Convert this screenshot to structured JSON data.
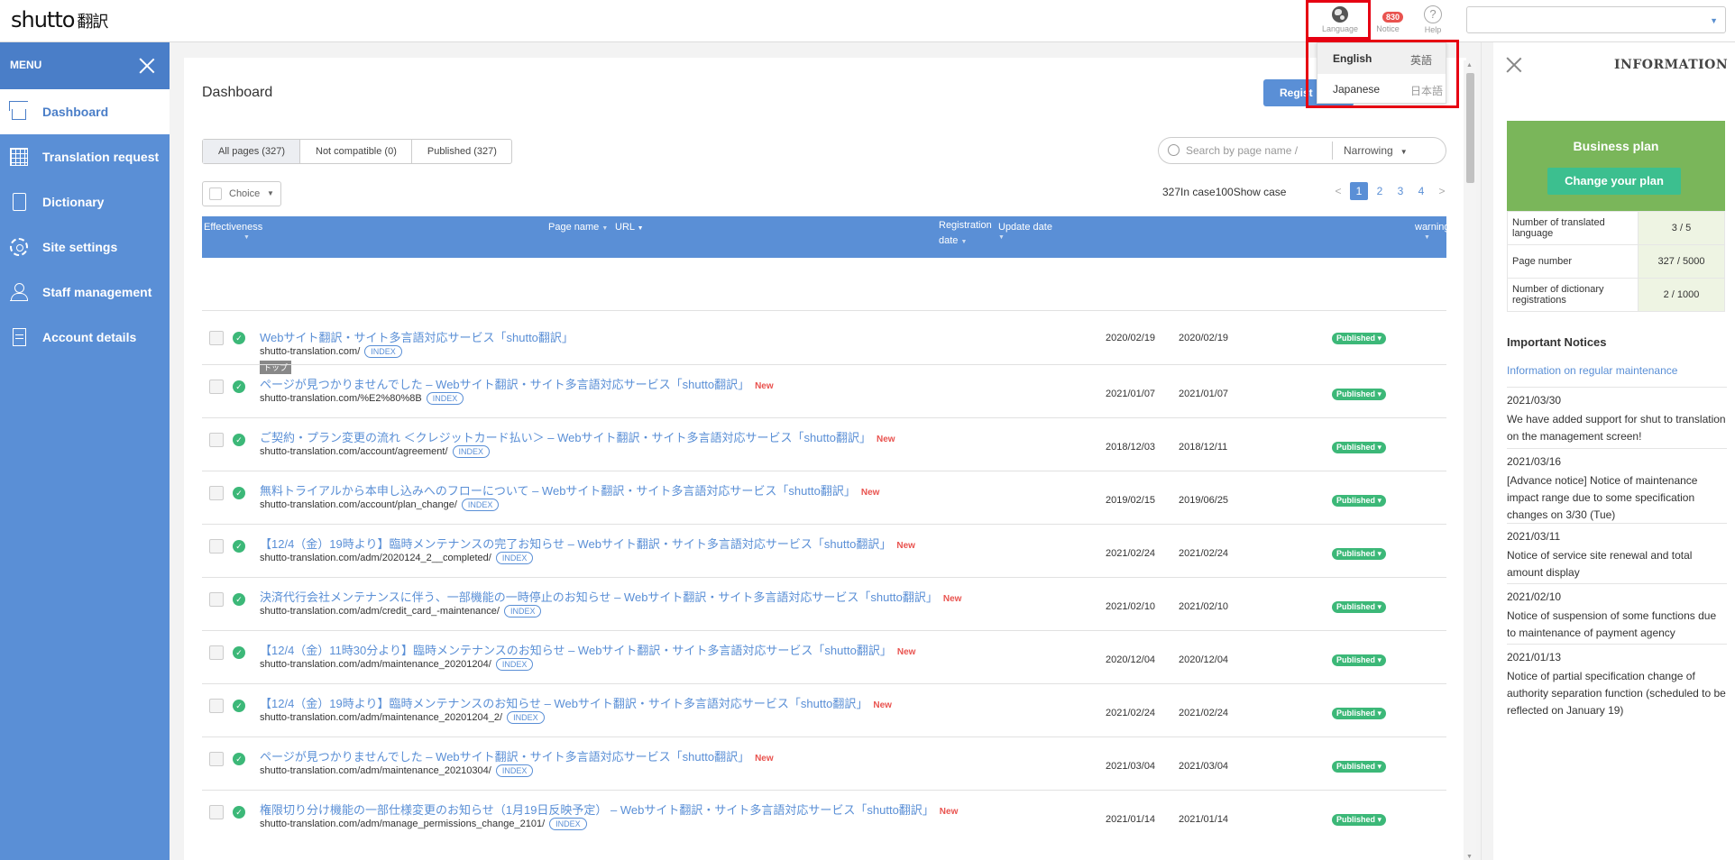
{
  "header": {
    "logo_en": "shutto",
    "logo_jp": "翻訳",
    "language_label": "Language",
    "notice_label": "Notice",
    "notice_count": "830",
    "help_label": "Help",
    "help_glyph": "?",
    "select_value": ""
  },
  "language_menu": {
    "options": [
      {
        "name": "English",
        "native": "英語",
        "selected": true
      },
      {
        "name": "Japanese",
        "native": "日本語",
        "selected": false
      }
    ],
    "highlight_color": "#e60012"
  },
  "sidebar": {
    "title": "MENU",
    "items": [
      {
        "label": "Dashboard",
        "icon": "home-icon",
        "active": true
      },
      {
        "label": "Translation request",
        "icon": "grid-icon"
      },
      {
        "label": "Dictionary",
        "icon": "book-icon"
      },
      {
        "label": "Site settings",
        "icon": "gear-icon"
      },
      {
        "label": "Staff management",
        "icon": "staff-icon"
      },
      {
        "label": "Account details",
        "icon": "document-icon"
      }
    ]
  },
  "main": {
    "title": "Dashboard",
    "register_button": "Regist",
    "tabs": [
      "All pages (327)",
      "Not compatible (0)",
      "Published (327)"
    ],
    "search_placeholder": "Search by page name / ",
    "narrowing": "Narrowing",
    "choice": "Choice",
    "count_text": "327In case100Show case",
    "pages": [
      "<",
      "1",
      "2",
      "3",
      "4",
      ">"
    ],
    "columns": {
      "effectiveness": "Effectiveness",
      "page_name": "Page name",
      "url": "URL",
      "registration_date_1": "Registration",
      "registration_date_2": "date",
      "update_date": "Update date",
      "warning": "warning"
    },
    "status_label": "Published",
    "index_label": "INDEX",
    "new_label": "New",
    "rows": [
      {
        "title": "Webサイト翻訳・サイト多言語対応サービス「shutto翻訳」",
        "url": "shutto-translation.com/",
        "reg": "2020/02/19",
        "upd": "2020/02/19",
        "new": false,
        "tag": "トップ"
      },
      {
        "title": "ページが見つかりませんでした – Webサイト翻訳・サイト多言語対応サービス「shutto翻訳」",
        "url": "shutto-translation.com/%E2%80%8B",
        "reg": "2021/01/07",
        "upd": "2021/01/07",
        "new": true
      },
      {
        "title": "ご契約・プラン変更の流れ ＜クレジットカード払い＞ – Webサイト翻訳・サイト多言語対応サービス「shutto翻訳」",
        "url": "shutto-translation.com/account/agreement/",
        "reg": "2018/12/03",
        "upd": "2018/12/11",
        "new": true
      },
      {
        "title": "無料トライアルから本申し込みへのフローについて – Webサイト翻訳・サイト多言語対応サービス「shutto翻訳」",
        "url": "shutto-translation.com/account/plan_change/",
        "reg": "2019/02/15",
        "upd": "2019/06/25",
        "new": true
      },
      {
        "title": "【12/4（金）19時より】臨時メンテナンスの完了お知らせ – Webサイト翻訳・サイト多言語対応サービス「shutto翻訳」",
        "url": "shutto-translation.com/adm/2020124_2__completed/",
        "reg": "2021/02/24",
        "upd": "2021/02/24",
        "new": true
      },
      {
        "title": "決済代行会社メンテナンスに伴う、一部機能の一時停止のお知らせ – Webサイト翻訳・サイト多言語対応サービス「shutto翻訳」",
        "url": "shutto-translation.com/adm/credit_card_-maintenance/",
        "reg": "2021/02/10",
        "upd": "2021/02/10",
        "new": true
      },
      {
        "title": "【12/4（金）11時30分より】臨時メンテナンスのお知らせ – Webサイト翻訳・サイト多言語対応サービス「shutto翻訳」",
        "url": "shutto-translation.com/adm/maintenance_20201204/",
        "reg": "2020/12/04",
        "upd": "2020/12/04",
        "new": true
      },
      {
        "title": "【12/4（金）19時より】臨時メンテナンスのお知らせ – Webサイト翻訳・サイト多言語対応サービス「shutto翻訳」",
        "url": "shutto-translation.com/adm/maintenance_20201204_2/",
        "reg": "2021/02/24",
        "upd": "2021/02/24",
        "new": true
      },
      {
        "title": "ページが見つかりませんでした – Webサイト翻訳・サイト多言語対応サービス「shutto翻訳」",
        "url": "shutto-translation.com/adm/maintenance_20210304/",
        "reg": "2021/03/04",
        "upd": "2021/03/04",
        "new": true
      },
      {
        "title": "権限切り分け機能の一部仕様変更のお知らせ（1月19日反映予定） – Webサイト翻訳・サイト多言語対応サービス「shutto翻訳」",
        "url": "shutto-translation.com/adm/manage_permissions_change_2101/",
        "reg": "2021/01/14",
        "upd": "2021/01/14",
        "new": true
      }
    ]
  },
  "info": {
    "title": "INFORMATION",
    "plan_title": "Business plan",
    "plan_button": "Change your plan",
    "stats": [
      {
        "label": "Number of translated language",
        "value": "3 / 5"
      },
      {
        "label": "Page number",
        "value": "327 / 5000"
      },
      {
        "label": "Number of dictionary registrations",
        "value": "2 / 1000"
      }
    ],
    "notices_heading": "Important Notices",
    "maintenance_link": "Information on regular maintenance",
    "notices": [
      {
        "date": "2021/03/30",
        "text": "We have added support for shut to translation on the management screen!"
      },
      {
        "date": "2021/03/16",
        "text": "[Advance notice] Notice of maintenance impact range due to some specification changes on 3/30 (Tue)"
      },
      {
        "date": "2021/03/11",
        "text": "Notice of service site renewal and total amount display"
      },
      {
        "date": "2021/02/10",
        "text": "Notice of suspension of some functions due to maintenance of payment agency"
      },
      {
        "date": "2021/01/13",
        "text": "Notice of partial specification change of authority separation function (scheduled to be reflected on January 19)"
      }
    ]
  }
}
